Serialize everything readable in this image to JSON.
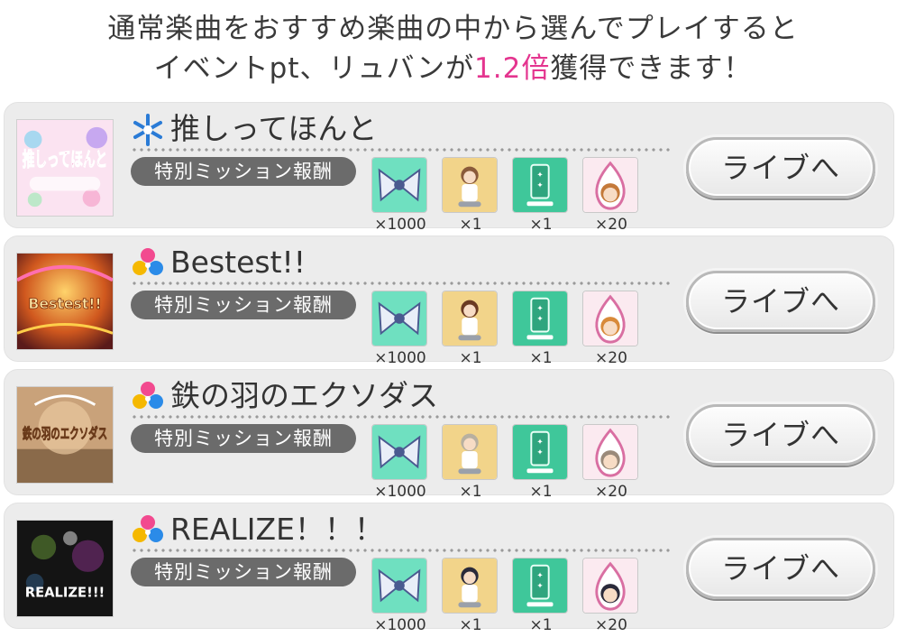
{
  "header": {
    "line1": "通常楽曲をおすすめ楽曲の中から選んでプレイすると",
    "line2_before": "イベントpt、リュバンが",
    "line2_highlight": "1.2倍",
    "line2_after": "獲得できます！"
  },
  "colors": {
    "highlight": "#e4358f",
    "row_bg": "#ececec",
    "mission_badge": "#6b6b6b"
  },
  "songs": [
    {
      "type_icon": "snowflake-icon",
      "title": "推しってほんと",
      "mission_label": "特別ミッション報酬",
      "rewards": [
        {
          "icon": "ribbon-icon",
          "count": "×1000"
        },
        {
          "icon": "idol-card-icon",
          "count": "×1"
        },
        {
          "icon": "ticket-icon",
          "count": "×1"
        },
        {
          "icon": "idol-badge-icon",
          "count": "×20"
        }
      ],
      "button_label": "ライブへ",
      "jacket_text": "推しってほんと"
    },
    {
      "type_icon": "clover-icon",
      "title": "Bestest!!",
      "mission_label": "特別ミッション報酬",
      "rewards": [
        {
          "icon": "ribbon-icon",
          "count": "×1000"
        },
        {
          "icon": "idol-card-icon",
          "count": "×1"
        },
        {
          "icon": "ticket-icon",
          "count": "×1"
        },
        {
          "icon": "idol-badge-icon",
          "count": "×20"
        }
      ],
      "button_label": "ライブへ",
      "jacket_text": "Bestest!!"
    },
    {
      "type_icon": "clover-icon",
      "title": "鉄の羽のエクソダス",
      "mission_label": "特別ミッション報酬",
      "rewards": [
        {
          "icon": "ribbon-icon",
          "count": "×1000"
        },
        {
          "icon": "idol-card-icon",
          "count": "×1"
        },
        {
          "icon": "ticket-icon",
          "count": "×1"
        },
        {
          "icon": "idol-badge-icon",
          "count": "×20"
        }
      ],
      "button_label": "ライブへ",
      "jacket_text": "鉄の羽のエクソダス"
    },
    {
      "type_icon": "clover-icon",
      "title": "REALIZE！！！",
      "mission_label": "特別ミッション報酬",
      "rewards": [
        {
          "icon": "ribbon-icon",
          "count": "×1000"
        },
        {
          "icon": "idol-card-icon",
          "count": "×1"
        },
        {
          "icon": "ticket-icon",
          "count": "×1"
        },
        {
          "icon": "idol-badge-icon",
          "count": "×20"
        }
      ],
      "button_label": "ライブへ",
      "jacket_text": "REALIZE!!!"
    }
  ]
}
